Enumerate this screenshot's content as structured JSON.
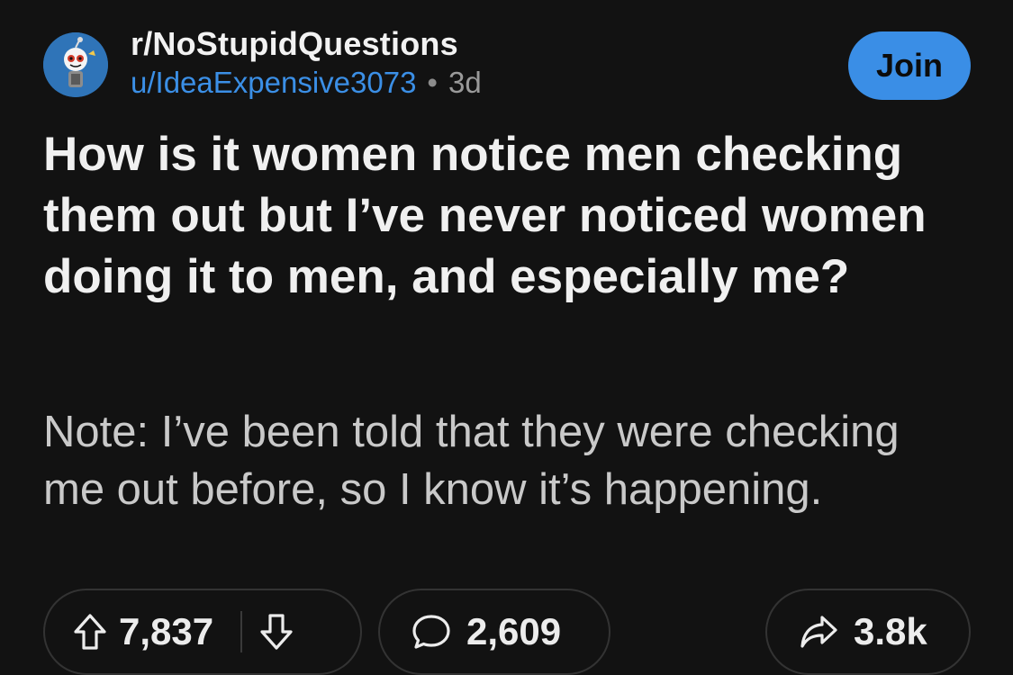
{
  "header": {
    "subreddit": "r/NoStupidQuestions",
    "username": "u/IdeaExpensive3073",
    "separator": "•",
    "age": "3d",
    "join_label": "Join"
  },
  "post": {
    "title": "How is it women notice men checking them out but I’ve never noticed women doing it to men, and especially me?",
    "body": "Note: I’ve been told that they were checking me out before, so I know it’s happening."
  },
  "actions": {
    "upvote_count": "7,837",
    "comment_count": "2,609",
    "share_count": "3.8k"
  },
  "colors": {
    "background": "#121212",
    "accent": "#3a8ee6",
    "username": "#3b8fe6"
  }
}
